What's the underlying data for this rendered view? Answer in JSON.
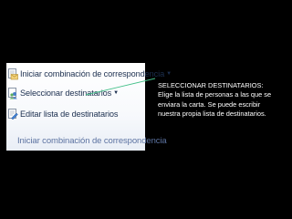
{
  "toolbar": {
    "items": [
      {
        "label": "Iniciar combinación de correspondencia",
        "icon": "mail-merge-icon",
        "has_dropdown": true
      },
      {
        "label": "Seleccionar destinatarios",
        "icon": "select-recipients-icon",
        "has_dropdown": true
      },
      {
        "label": "Editar lista de destinatarios",
        "icon": "edit-list-icon",
        "has_dropdown": false
      }
    ],
    "group_label": "Iniciar combinación de correspondencia",
    "dropdown_glyph": "▼"
  },
  "annotation": {
    "title": "SELECCIONAR DESTINATARIOS:",
    "description": "Elige la lista de personas a las que se enviara la carta. Se puede escribir nuestra propia lista de destinatarios."
  },
  "colors": {
    "background": "#000000",
    "connector": "#44c18a",
    "toolbar_text": "#1c2f4f",
    "group_label_text": "#5c73a1",
    "annotation_text": "#ffffff"
  }
}
